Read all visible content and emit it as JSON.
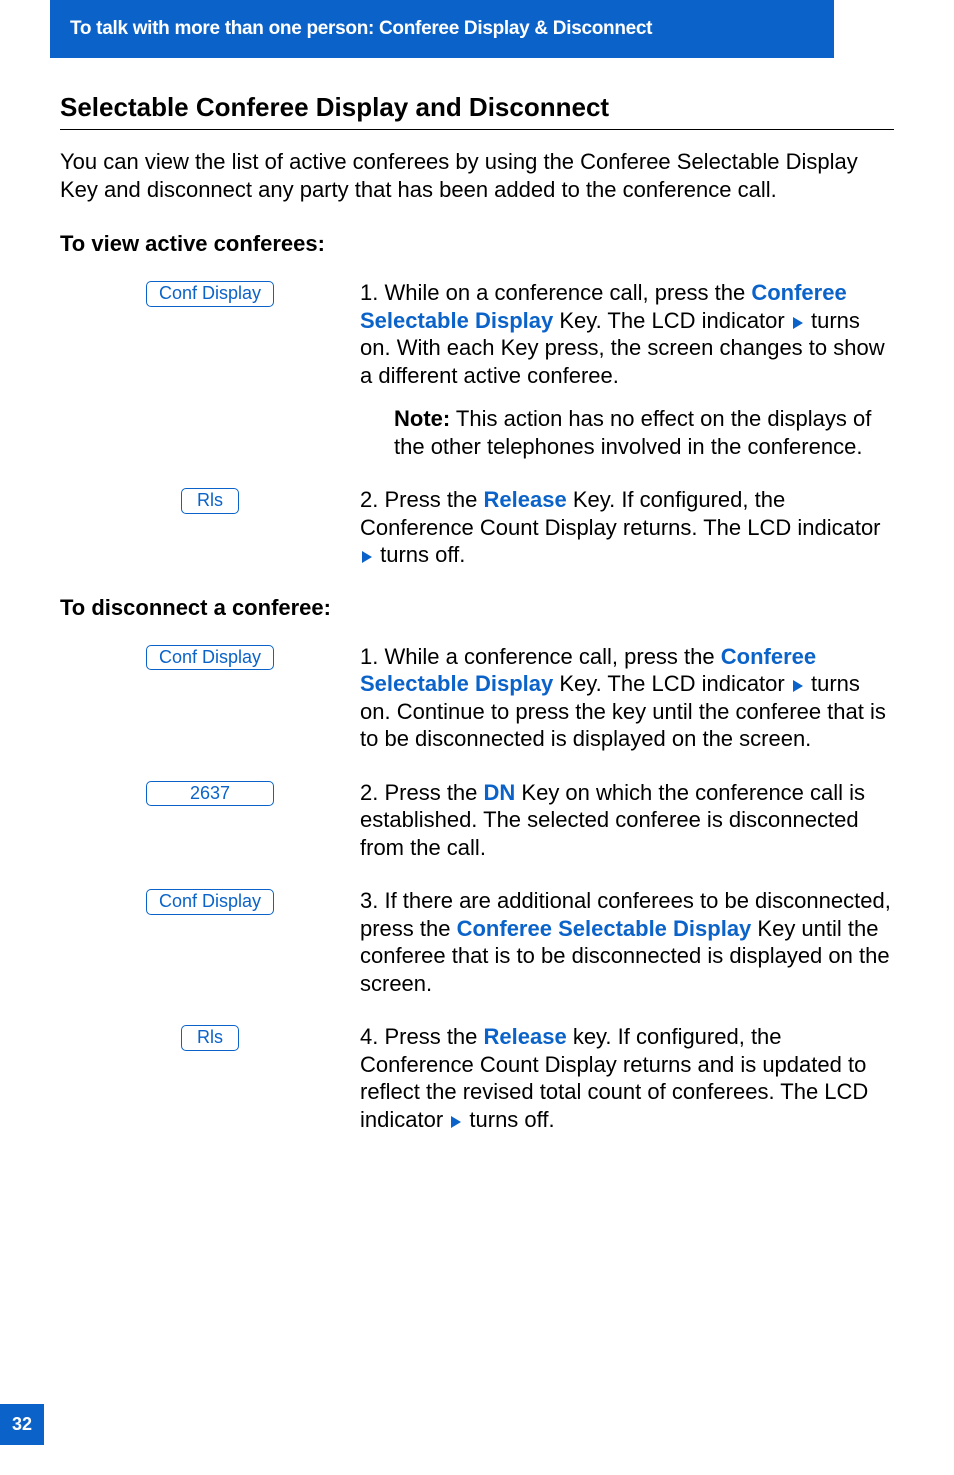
{
  "header": {
    "band": "To talk with more than one person: Conferee Display & Disconnect"
  },
  "section_title": "Selectable Conferee Display and Disconnect",
  "intro": "You can view the list of active conferees by using the Conferee Selectable Display Key and disconnect any party that has been added to the conference call.",
  "view": {
    "heading": "To view active conferees:",
    "steps": [
      {
        "key_label": "Conf Display",
        "num": "1. ",
        "pre": "While on a conference call, press the ",
        "key_name": "Conferee Selectable Display",
        "after_key": " Key. The LCD indicator ",
        "after_ind": " turns on. With each Key press, the screen changes to show a different active conferee.",
        "note_label": "Note:",
        "note_text": " This action has no effect on the displays of the other telephones involved in the conference."
      },
      {
        "key_label": "Rls",
        "num": "2. ",
        "pre": "Press the ",
        "key_name": "Release",
        "after_key": " Key. If configured, the Conference Count Display returns. The LCD indicator ",
        "after_ind": " turns off."
      }
    ]
  },
  "disconnect": {
    "heading": "To disconnect a conferee:",
    "steps": [
      {
        "key_label": "Conf Display",
        "num": "1. ",
        "pre": "While a conference call, press the ",
        "key_name": "Conferee Selectable Display",
        "after_key": " Key. The LCD indicator ",
        "after_ind": " turns on. Continue to press the key until the conferee that is to be disconnected is displayed on the screen."
      },
      {
        "key_label": "2637",
        "num": "2. ",
        "pre": "Press the ",
        "key_name": "DN",
        "after_key": " Key on which the conference call is established. The selected conferee is disconnected from the call."
      },
      {
        "key_label": "Conf Display",
        "num": "3. ",
        "pre": "If there are additional conferees to be disconnected, press the ",
        "key_name": "Conferee Selectable Display",
        "after_key": " Key until the conferee that is to be disconnected is displayed on the screen."
      },
      {
        "key_label": "Rls",
        "num": "4. ",
        "pre": "Press the ",
        "key_name": "Release",
        "after_key": " key. If configured, the Conference Count Display returns and is updated to reflect the revised total count of conferees. The LCD indicator ",
        "after_ind": " turns off."
      }
    ]
  },
  "page_number": "32"
}
